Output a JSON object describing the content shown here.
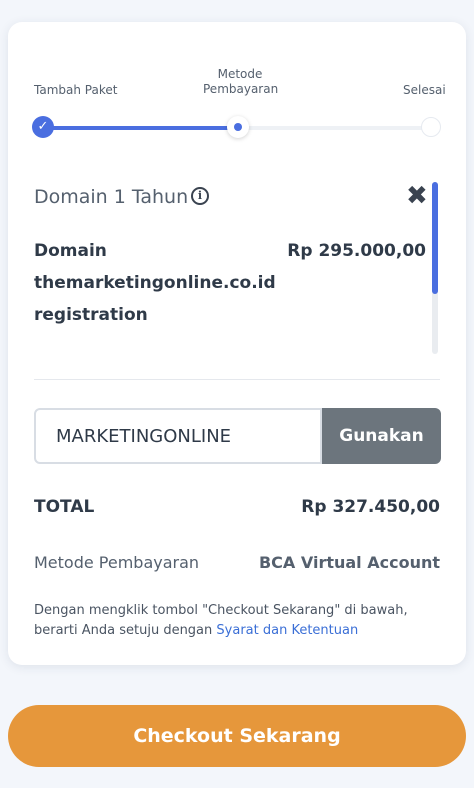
{
  "stepper": {
    "steps": [
      {
        "label": "Tambah Paket",
        "state": "done"
      },
      {
        "label": "Metode Pembayaran",
        "state": "current"
      },
      {
        "label": "Selesai",
        "state": "pending"
      }
    ],
    "progress_fraction": 0.5,
    "check_glyph": "✓"
  },
  "product": {
    "title": "Domain 1 Tahun",
    "info_glyph": "i",
    "close_glyph": "✖",
    "items": [
      {
        "line1": "Domain",
        "line2": "themarketingonline.co.id",
        "line3": "registration",
        "price": "Rp 295.000,00"
      }
    ]
  },
  "coupon": {
    "value": "MARKETINGONLINE",
    "apply_label": "Gunakan"
  },
  "summary": {
    "total_label": "TOTAL",
    "total_value": "Rp 327.450,00",
    "method_label": "Metode Pembayaran",
    "method_value": "BCA Virtual Account"
  },
  "terms": {
    "text": "Dengan mengklik tombol \"Checkout Sekarang\" di bawah, berarti Anda setuju dengan",
    "link": "Syarat dan Ketentuan"
  },
  "checkout": {
    "label": "Checkout Sekarang"
  },
  "colors": {
    "accent": "#4a6ee0",
    "checkout": "#e6973b",
    "apply_button": "#6c757d"
  }
}
